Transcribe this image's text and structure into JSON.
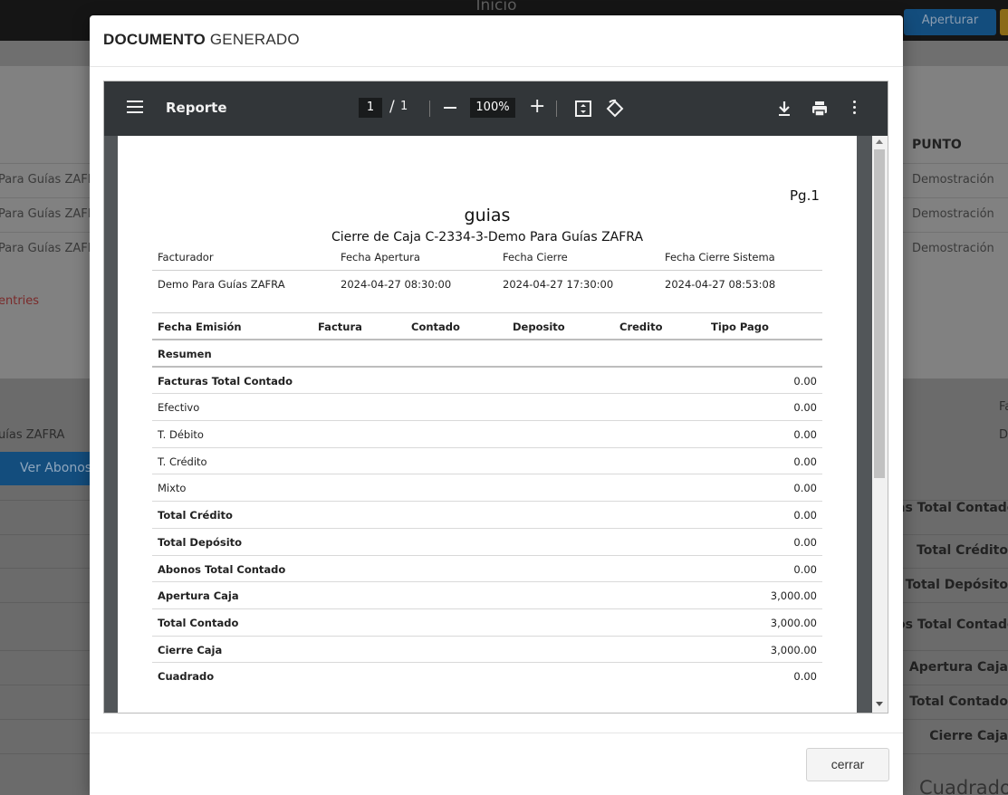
{
  "background": {
    "top_title": "Inicio",
    "top_button": "Aperturar",
    "column_punto": "PUNTO",
    "rows": [
      {
        "left": "Para Guías ZAFRA",
        "right": "Demostración"
      },
      {
        "left": "Para Guías ZAFRA",
        "right": "Demostración"
      },
      {
        "left": "Para Guías ZAFRA",
        "right": "Demostración"
      }
    ],
    "entries": "entries",
    "zafra": "uías ZAFRA",
    "fa": "Fa",
    "de": "De",
    "ver_abonos": "Ver Abonos",
    "right_totals": [
      "as Total Contado",
      "Total Crédito",
      "Total Depósito",
      "os Total Contado",
      "Apertura Caja",
      "Total Contado",
      "Cierre Caja"
    ],
    "cuadrado": "Cuadrado"
  },
  "modal": {
    "title_bold": "DOCUMENTO",
    "title_rest": "GENERADO",
    "close_label": "cerrar"
  },
  "viewer": {
    "title": "Reporte",
    "current_page": "1",
    "page_separator": "/",
    "total_pages": "1",
    "zoom": "100%"
  },
  "report": {
    "page_label": "Pg.1",
    "title": "guias",
    "subtitle": "Cierre de Caja C-2334-3-Demo Para Guías ZAFRA",
    "info_headers": [
      "Facturador",
      "Fecha Apertura",
      "Fecha Cierre",
      "Fecha Cierre Sistema"
    ],
    "info_values": [
      "Demo Para Guías ZAFRA",
      "2024-04-27 08:30:00",
      "2024-04-27 17:30:00",
      "2024-04-27 08:53:08"
    ],
    "table_headers": [
      "Fecha Emisión",
      "Factura",
      "Contado",
      "Deposito",
      "Credito",
      "Tipo Pago"
    ],
    "rows": [
      {
        "label": "Resumen",
        "value": "",
        "bold": true
      },
      {
        "label": "Facturas Total Contado",
        "value": "0.00",
        "bold": true
      },
      {
        "label": "Efectivo",
        "value": "0.00",
        "bold": false
      },
      {
        "label": "T. Débito",
        "value": "0.00",
        "bold": false
      },
      {
        "label": "T. Crédito",
        "value": "0.00",
        "bold": false
      },
      {
        "label": "Mixto",
        "value": "0.00",
        "bold": false
      },
      {
        "label": "Total Crédito",
        "value": "0.00",
        "bold": true
      },
      {
        "label": "Total Depósito",
        "value": "0.00",
        "bold": true
      },
      {
        "label": "Abonos Total Contado",
        "value": "0.00",
        "bold": true
      },
      {
        "label": "Apertura Caja",
        "value": "3,000.00",
        "bold": true
      },
      {
        "label": "Total Contado",
        "value": "3,000.00",
        "bold": true
      },
      {
        "label": "Cierre Caja",
        "value": "3,000.00",
        "bold": true
      },
      {
        "label": "Cuadrado",
        "value": "0.00",
        "bold": true
      }
    ]
  }
}
